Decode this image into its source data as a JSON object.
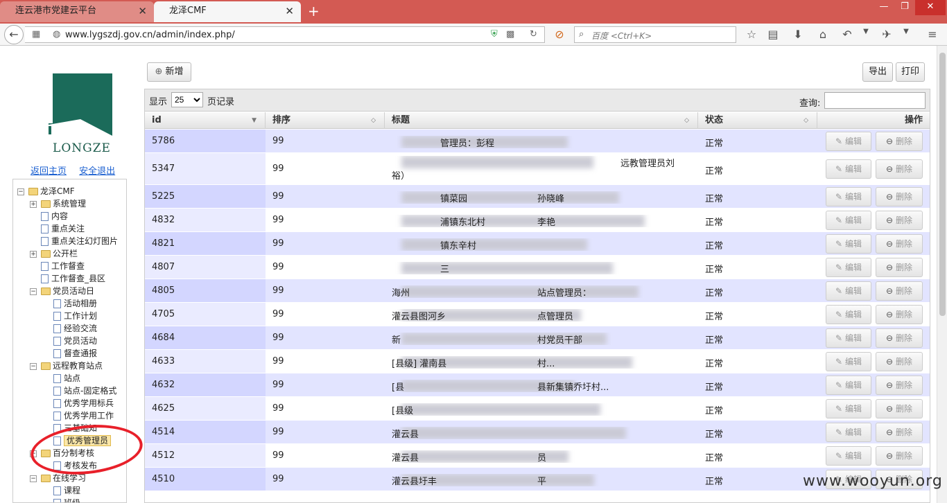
{
  "browser": {
    "tabs": [
      {
        "label": "连云港市党建云平台",
        "close": "✕"
      },
      {
        "label": "龙泽CMF",
        "close": "✕"
      }
    ],
    "new_tab": "+",
    "window_controls": {
      "min": "—",
      "max": "❐",
      "close": "✕"
    },
    "url": "www.lygszdj.gov.cn/admin/index.php/",
    "search_placeholder": "百度 <Ctrl+K>"
  },
  "sidebar": {
    "logo_text": "LONGZE",
    "links": {
      "home": "返回主页",
      "logout": "安全退出"
    },
    "tree": [
      {
        "label": "龙泽CMF",
        "type": "folder",
        "exp": "−",
        "level": 0
      },
      {
        "label": "系统管理",
        "type": "folder",
        "exp": "+",
        "level": 1
      },
      {
        "label": "内容",
        "type": "file",
        "level": 1
      },
      {
        "label": "重点关注",
        "type": "file",
        "level": 1
      },
      {
        "label": "重点关注幻灯图片",
        "type": "file",
        "level": 1
      },
      {
        "label": "公开栏",
        "type": "folder",
        "exp": "+",
        "level": 1
      },
      {
        "label": "工作督查",
        "type": "file",
        "level": 1
      },
      {
        "label": "工作督查_县区",
        "type": "file",
        "level": 1
      },
      {
        "label": "党员活动日",
        "type": "folder",
        "exp": "−",
        "level": 1
      },
      {
        "label": "活动相册",
        "type": "file",
        "level": 2
      },
      {
        "label": "工作计划",
        "type": "file",
        "level": 2
      },
      {
        "label": "经验交流",
        "type": "file",
        "level": 2
      },
      {
        "label": "党员活动",
        "type": "file",
        "level": 2
      },
      {
        "label": "督查通报",
        "type": "file",
        "level": 2
      },
      {
        "label": "远程教育站点",
        "type": "folder",
        "exp": "−",
        "level": 1
      },
      {
        "label": "站点",
        "type": "file",
        "level": 2
      },
      {
        "label": "站点-固定格式",
        "type": "file",
        "level": 2
      },
      {
        "label": "优秀学用标兵",
        "type": "file",
        "level": 2
      },
      {
        "label": "优秀学用工作",
        "type": "file",
        "level": 2
      },
      {
        "label": "三基础知",
        "type": "file",
        "level": 2
      },
      {
        "label": "优秀管理员",
        "type": "file",
        "level": 2,
        "selected": true
      },
      {
        "label": "百分制考核",
        "type": "folder",
        "exp": "−",
        "level": 1
      },
      {
        "label": "考核发布",
        "type": "file",
        "level": 2
      },
      {
        "label": "在线学习",
        "type": "folder",
        "exp": "−",
        "level": 1
      },
      {
        "label": "课程",
        "type": "file",
        "level": 2
      },
      {
        "label": "班级",
        "type": "file",
        "level": 2
      }
    ]
  },
  "toolbar": {
    "add_label": "新增",
    "export_label": "导出",
    "print_label": "打印",
    "show_label": "显示",
    "page_size": "25",
    "records_label": "页记录",
    "query_label": "查询:"
  },
  "table": {
    "headers": {
      "id": "id",
      "order": "排序",
      "title": "标题",
      "status": "状态",
      "ops": "操作"
    },
    "edit_label": "编辑",
    "delete_label": "删除",
    "rows": [
      {
        "id": "5786",
        "order": "99",
        "title_fragments": [
          "管理员：彭程"
        ],
        "status": "正常"
      },
      {
        "id": "5347",
        "order": "99",
        "title_fragments": [
          "远教管理员刘",
          "裕）"
        ],
        "status": "正常"
      },
      {
        "id": "5225",
        "order": "99",
        "title_fragments": [
          "镇菜园",
          "孙晓峰"
        ],
        "status": "正常"
      },
      {
        "id": "4832",
        "order": "99",
        "title_fragments": [
          "浦镇东北村",
          "李艳"
        ],
        "status": "正常"
      },
      {
        "id": "4821",
        "order": "99",
        "title_fragments": [
          "镇东辛村"
        ],
        "status": "正常"
      },
      {
        "id": "4807",
        "order": "99",
        "title_fragments": [
          "三"
        ],
        "status": "正常"
      },
      {
        "id": "4805",
        "order": "99",
        "title_fragments": [
          "海州",
          "站点管理员："
        ],
        "status": "正常"
      },
      {
        "id": "4705",
        "order": "99",
        "title_fragments": [
          "灌云县图河乡",
          "点管理员"
        ],
        "status": "正常"
      },
      {
        "id": "4684",
        "order": "99",
        "title_fragments": [
          "新",
          "村党员干部"
        ],
        "status": "正常"
      },
      {
        "id": "4633",
        "order": "99",
        "title_fragments": [
          "[县级] 灌南县",
          "村..."
        ],
        "status": "正常"
      },
      {
        "id": "4632",
        "order": "99",
        "title_fragments": [
          "[县",
          "县新集镇乔圩村..."
        ],
        "status": "正常"
      },
      {
        "id": "4625",
        "order": "99",
        "title_fragments": [
          "[县级"
        ],
        "status": "正常"
      },
      {
        "id": "4514",
        "order": "99",
        "title_fragments": [
          "灌云县"
        ],
        "status": "正常"
      },
      {
        "id": "4512",
        "order": "99",
        "title_fragments": [
          "灌云县",
          "员"
        ],
        "status": "正常"
      },
      {
        "id": "4510",
        "order": "99",
        "title_fragments": [
          "灌云县圩丰",
          "平"
        ],
        "status": "正常"
      }
    ]
  },
  "watermark": "www.wooyun.org"
}
